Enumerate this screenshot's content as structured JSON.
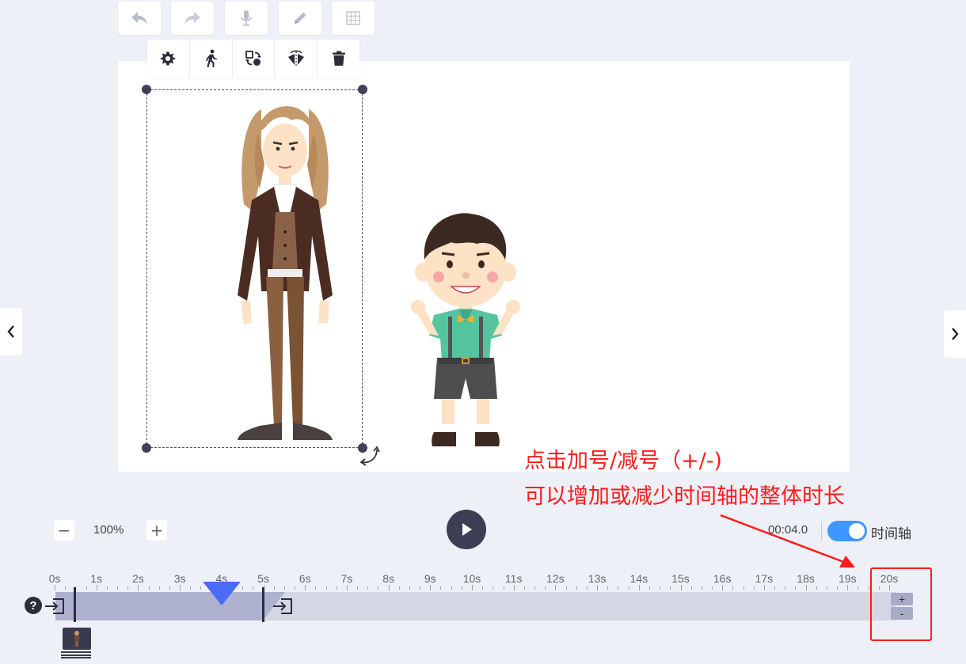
{
  "top_toolbar": {
    "buttons": [
      {
        "icon": "undo-icon"
      },
      {
        "icon": "redo-icon"
      },
      {
        "icon": "microphone-icon"
      },
      {
        "icon": "pencil-icon"
      },
      {
        "icon": "grid-icon"
      }
    ]
  },
  "object_toolbar": {
    "buttons": [
      {
        "icon": "gear-icon"
      },
      {
        "icon": "walking-person-icon"
      },
      {
        "icon": "swap-shapes-icon"
      },
      {
        "icon": "flip-horizontal-icon"
      },
      {
        "icon": "trash-icon"
      }
    ]
  },
  "annotation": {
    "line1": "点击加号/减号（+/-)",
    "line2": "可以增加或减少时间轴的整体时长",
    "color": "#ff1c1c"
  },
  "controls": {
    "zoom_minus": "−",
    "zoom_value": "100%",
    "zoom_plus": "+",
    "time": "00:04.0",
    "toggle_label": "时间轴",
    "toggle_on": true
  },
  "timeline": {
    "ruler": [
      "0s",
      "1s",
      "2s",
      "3s",
      "4s",
      "5s",
      "6s",
      "7s",
      "8s",
      "9s",
      "10s",
      "11s",
      "12s",
      "13s",
      "14s",
      "15s",
      "16s",
      "17s",
      "18s",
      "19s",
      "20s"
    ],
    "help": "?",
    "plus": "+",
    "minus": "-",
    "playhead_seconds": 4,
    "clip_end_seconds": 5
  },
  "colors": {
    "accent": "#3e97ff",
    "playhead": "#4a6cf7",
    "dark": "#3d3d55",
    "highlight": "#ff1c1c"
  }
}
